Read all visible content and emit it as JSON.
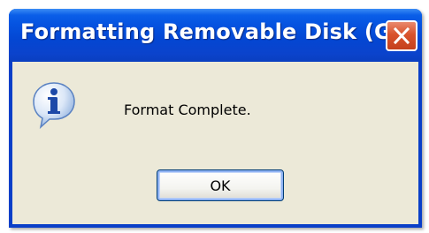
{
  "window": {
    "title": "Formatting Removable Disk (G:)",
    "close_icon": "close-icon"
  },
  "dialog": {
    "icon": "info-icon",
    "message": "Format Complete.",
    "ok_label": "OK"
  },
  "colors": {
    "titlebar": "#0553e0",
    "border": "#0a3fc8",
    "client_background": "#ece9d8",
    "close_button": "#d9532c"
  }
}
